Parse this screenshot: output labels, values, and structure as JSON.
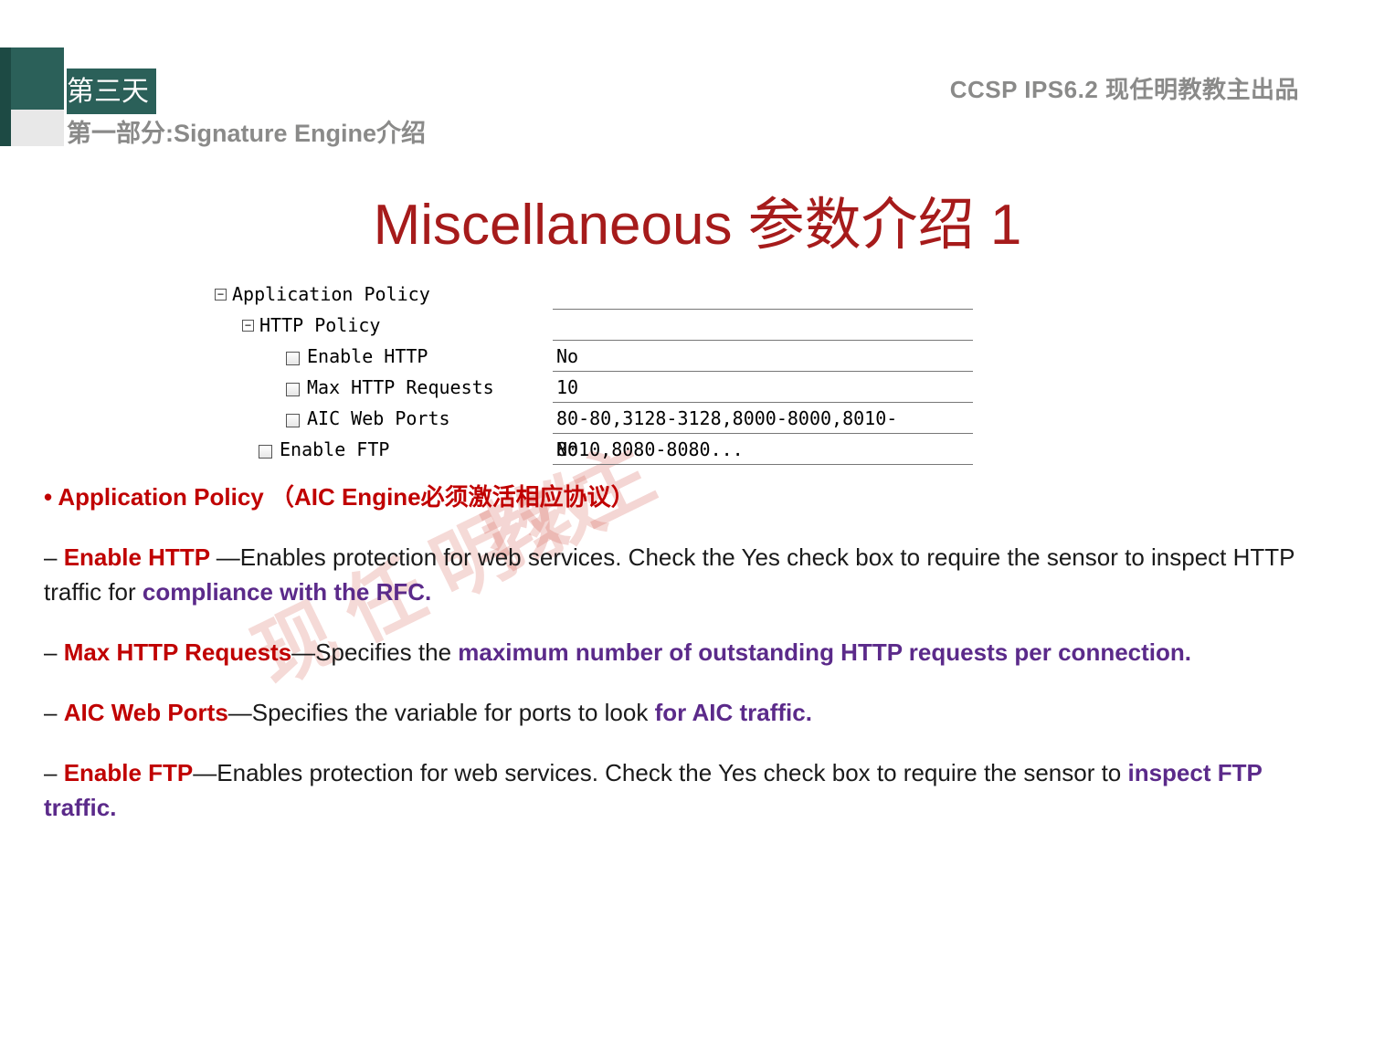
{
  "header": {
    "day": "第三天",
    "section": "第一部分:Signature Engine介绍",
    "course": "CCSP IPS6.2  现任明教教主出品"
  },
  "title": "Miscellaneous 参数介绍 1",
  "watermark_a": "教主",
  "watermark_b": "现任明教",
  "tree": {
    "root": "Application Policy",
    "http_policy": "HTTP Policy",
    "items": [
      {
        "label": "Enable HTTP",
        "value": "No"
      },
      {
        "label": "Max HTTP Requests",
        "value": "10"
      },
      {
        "label": "AIC Web Ports",
        "value": "80-80,3128-3128,8000-8000,8010-8010,8080-8080..."
      }
    ],
    "ftp": {
      "label": "Enable FTP",
      "value": "No"
    }
  },
  "content": {
    "app_policy_lead": "• ",
    "app_policy_bold": "Application Policy （AIC Engine",
    "app_policy_tail_red": "必须激活相应协议）",
    "http": {
      "name": "Enable HTTP ",
      "dash": "  – ",
      "mid": "—Enables protection for web services. Check the Yes check box to require the sensor to inspect HTTP traffic for ",
      "purple": "compliance with the RFC."
    },
    "max": {
      "name": "Max HTTP Requests",
      "mid": "—Specifies the ",
      "purple": "maximum number of outstanding HTTP requests per connection."
    },
    "aic": {
      "name": "AIC Web Ports",
      "mid": "—Specifies the variable for ports to look ",
      "purple": "for AIC traffic."
    },
    "ftp": {
      "name": "Enable FTP",
      "mid": "—Enables protection for web services. Check the Yes check box to require the sensor to ",
      "purple": "inspect FTP traffic."
    }
  }
}
